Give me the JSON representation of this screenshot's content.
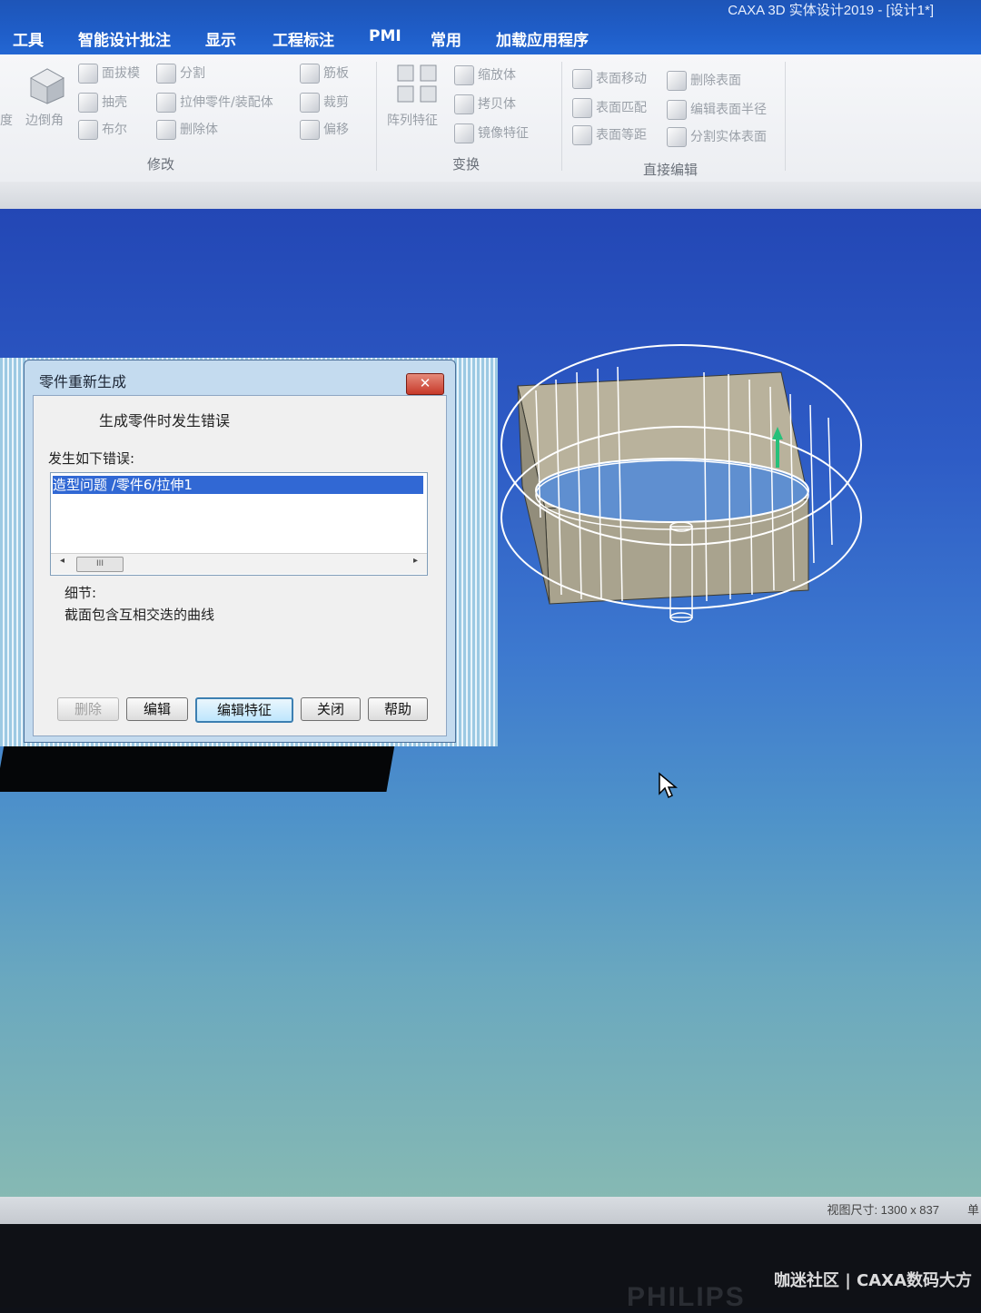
{
  "window": {
    "title": "CAXA 3D 实体设计2019 - [设计1*]"
  },
  "menu": [
    "工具",
    "智能设计批注",
    "显示",
    "工程标注",
    "PMI",
    "常用",
    "加载应用程序"
  ],
  "ribbon": {
    "left_partial": [
      "度",
      "边倒角"
    ],
    "modify": {
      "items": [
        "面拔模",
        "分割",
        "筋板",
        "抽壳",
        "拉伸零件/装配体",
        "裁剪",
        "布尔",
        "删除体",
        "偏移"
      ],
      "label": "修改"
    },
    "transform": {
      "items": [
        "阵列特征",
        "缩放体",
        "拷贝体",
        "镜像特征"
      ],
      "label": "变换"
    },
    "direct_edit": {
      "items": [
        "表面移动",
        "删除表面",
        "表面匹配",
        "编辑表面半径",
        "表面等距",
        "分割实体表面"
      ],
      "label": "直接编辑"
    }
  },
  "dialog": {
    "title": "零件重新生成",
    "close_symbol": "✕",
    "message": "生成零件时发生错误",
    "errors_label": "发生如下错误:",
    "errors": [
      "造型问题 /零件6/拉伸1"
    ],
    "scroll_thumb": "III",
    "detail_label": "细节:",
    "detail_text": "截面包含互相交迭的曲线",
    "buttons": {
      "delete": "删除",
      "edit": "编辑",
      "edit_feature": "编辑特征",
      "close": "关闭",
      "help": "帮助"
    }
  },
  "status": {
    "view_size": "视图尺寸: 1300 x 837",
    "edge_char": "单"
  },
  "watermark": "咖迷社区 | CAXA数码大方",
  "monitor_brand": "PHILIPS",
  "colors": {
    "titlebar": "#1f5ec9",
    "selection": "#3168d4",
    "close_button": "#c7392a",
    "viewport_top": "#2347b5",
    "viewport_bottom": "#86b9b3"
  }
}
